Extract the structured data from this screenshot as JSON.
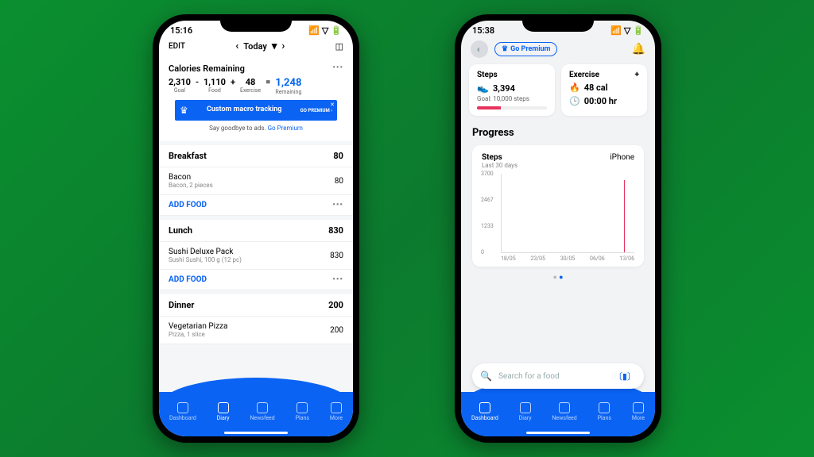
{
  "phoneLeft": {
    "status": {
      "time": "15:16",
      "signals": "􀋦 􀙇 􀛨"
    },
    "topbar": {
      "edit": "EDIT",
      "prev": "‹",
      "day": "Today",
      "dayChevron": "▾",
      "next": "›"
    },
    "calories": {
      "title": "Calories Remaining",
      "goal": {
        "value": "2,310",
        "label": "Goal"
      },
      "food": {
        "value": "1,110",
        "label": "Food"
      },
      "exercise": {
        "value": "48",
        "label": "Exercise"
      },
      "remaining": {
        "value": "1,248",
        "label": "Remaining"
      },
      "minus": "-",
      "plus": "+",
      "equals": "="
    },
    "promo": {
      "headline": "Custom macro tracking",
      "cta": "GO PREMIUM ›",
      "close": "✕"
    },
    "adNote": {
      "text": "Say goodbye to ads. ",
      "link": "Go Premium"
    },
    "meals": [
      {
        "name": "Breakfast",
        "total": "80",
        "items": [
          {
            "title": "Bacon",
            "subtitle": "Bacon, 2 pieces",
            "cal": "80"
          }
        ],
        "action": "ADD FOOD"
      },
      {
        "name": "Lunch",
        "total": "830",
        "items": [
          {
            "title": "Sushi Deluxe Pack",
            "subtitle": "Sushi Sushi, 100 g (12 pc)",
            "cal": "830"
          }
        ],
        "action": "ADD FOOD"
      },
      {
        "name": "Dinner",
        "total": "200",
        "items": [
          {
            "title": "Vegetarian Pizza",
            "subtitle": "Pizza, 1 slice",
            "cal": "200"
          }
        ],
        "action": "ADD FOOD"
      }
    ],
    "tabs": [
      {
        "label": "Dashboard",
        "active": false
      },
      {
        "label": "Diary",
        "active": true
      },
      {
        "label": "Newsfeed",
        "active": false
      },
      {
        "label": "Plans",
        "active": false
      },
      {
        "label": "More",
        "active": false
      }
    ]
  },
  "phoneRight": {
    "status": {
      "time": "15:38"
    },
    "header": {
      "goPremium": "Go Premium"
    },
    "steps": {
      "title": "Steps",
      "value": "3,394",
      "goal": "Goal: 10,000 steps",
      "progressPct": 34
    },
    "exercise": {
      "title": "Exercise",
      "plus": "+",
      "calories": "48 cal",
      "duration": "00:00 hr"
    },
    "progressTitle": "Progress",
    "chart": {
      "title": "Steps",
      "subtitle": "Last 30 days",
      "device": "iPhone",
      "yticks": [
        "3700",
        "2467",
        "1233",
        "0"
      ],
      "xticks": [
        "18/05",
        "23/05",
        "30/05",
        "06/06",
        "13/06"
      ]
    },
    "search": {
      "placeholder": "Search for a food"
    },
    "tabs": [
      {
        "label": "Dashboard",
        "active": true
      },
      {
        "label": "Diary",
        "active": false
      },
      {
        "label": "Newsfeed",
        "active": false
      },
      {
        "label": "Plans",
        "active": false
      },
      {
        "label": "More",
        "active": false
      }
    ]
  },
  "chart_data": {
    "type": "line",
    "title": "Steps",
    "subtitle": "Last 30 days",
    "xlabel": "",
    "ylabel": "",
    "ylim": [
      0,
      3700
    ],
    "x": [
      "18/05",
      "23/05",
      "30/05",
      "06/06",
      "13/06"
    ],
    "series": [
      {
        "name": "Steps (iPhone)",
        "x": [
          "13/06"
        ],
        "values": [
          3394
        ]
      }
    ],
    "annotations": {
      "device": "iPhone"
    }
  }
}
